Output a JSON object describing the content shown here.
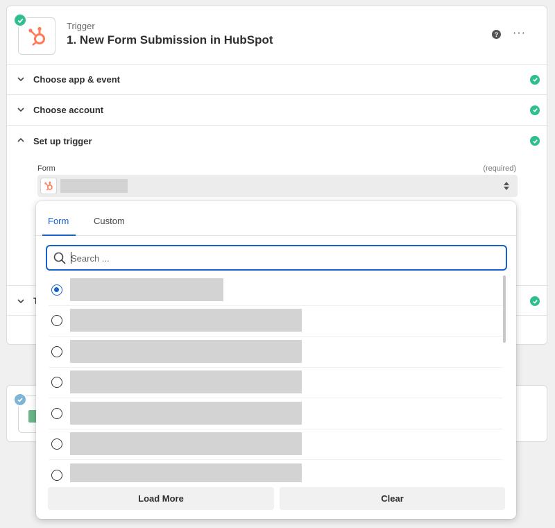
{
  "trigger": {
    "kind": "Trigger",
    "title": "1. New Form Submission in HubSpot",
    "more_label": "···",
    "help_label": "?"
  },
  "sections": [
    {
      "label": "Choose app & event",
      "state": "complete"
    },
    {
      "label": "Choose account",
      "state": "complete"
    },
    {
      "label": "Set up trigger",
      "state": "complete"
    }
  ],
  "form_field": {
    "label": "Form",
    "required_text": "(required)"
  },
  "test_section": {
    "label": "T",
    "state": "complete"
  },
  "dropdown": {
    "tabs": [
      {
        "label": "Form",
        "active": true
      },
      {
        "label": "Custom",
        "active": false
      }
    ],
    "search": {
      "placeholder": "Search ...",
      "value": ""
    },
    "options": [
      {
        "selected": true
      },
      {
        "selected": false
      },
      {
        "selected": false
      },
      {
        "selected": false
      },
      {
        "selected": false
      },
      {
        "selected": false
      },
      {
        "selected": false
      }
    ],
    "load_more_label": "Load More",
    "clear_label": "Clear"
  },
  "colors": {
    "accent": "#1462cc",
    "success": "#2fbf8f",
    "hubspot": "#ff7a59",
    "redacted": "#d3d3d3"
  }
}
